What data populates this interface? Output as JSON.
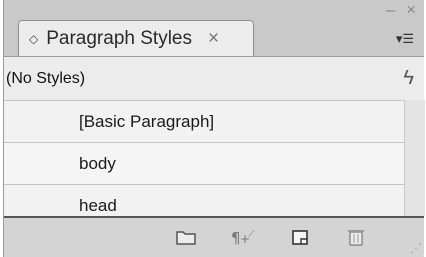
{
  "panel": {
    "title": "Paragraph Styles",
    "tab_close": "×",
    "minimize": "–",
    "close": "×",
    "menu": "▾☰"
  },
  "toolbar": {
    "current_style": "(No Styles)",
    "quick_apply": "ϟ"
  },
  "styles": [
    {
      "label": "[Basic Paragraph]"
    },
    {
      "label": "body"
    },
    {
      "label": "head"
    }
  ],
  "footer": {
    "icons": [
      "folder-icon",
      "clear-overrides-icon",
      "new-style-icon",
      "delete-icon"
    ]
  }
}
